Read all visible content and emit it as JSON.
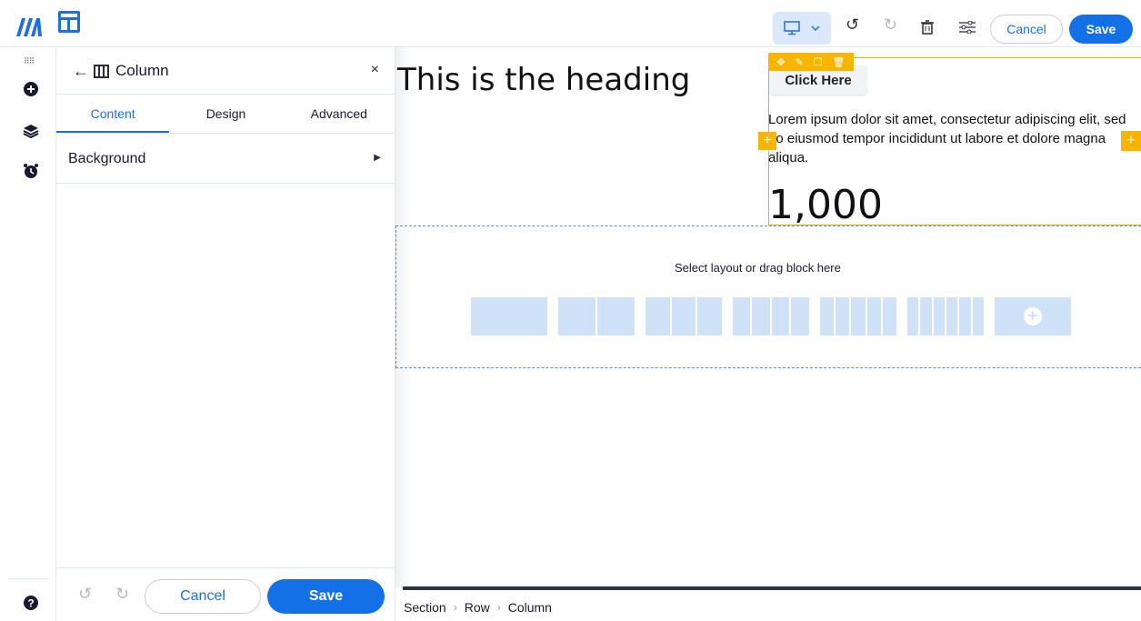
{
  "topbar": {
    "cancel_label": "Cancel",
    "save_label": "Save",
    "device": "desktop",
    "icons": [
      "logo",
      "layout-icon",
      "desktop-icon",
      "chevron-down-icon",
      "undo-icon",
      "redo-icon",
      "trash-icon",
      "settings-sliders-icon"
    ]
  },
  "rail": {
    "icons": [
      "drag-grip-icon",
      "add-circle-icon",
      "layers-icon",
      "alarm-clock-icon",
      "help-icon"
    ]
  },
  "panel": {
    "title": "Column",
    "tabs": [
      {
        "label": "Content",
        "active": true
      },
      {
        "label": "Design",
        "active": false
      },
      {
        "label": "Advanced",
        "active": false
      }
    ],
    "sections": [
      {
        "label": "Background"
      }
    ],
    "footer": {
      "cancel_label": "Cancel",
      "save_label": "Save"
    }
  },
  "canvas": {
    "heading": "This is the heading",
    "button_label": "Click Here",
    "paragraph": "Lorem ipsum dolor sit amet, consectetur adipiscing elit, sed do eiusmod tempor incididunt ut labore et dolore magna aliqua.",
    "number": "1,000",
    "dropzone_text": "Select layout or drag block here",
    "layout_options": [
      1,
      2,
      3,
      4,
      5,
      6
    ],
    "selection_color": "#f7b500",
    "accent": "#1470e6"
  },
  "breadcrumb": [
    "Section",
    "Row",
    "Column"
  ]
}
